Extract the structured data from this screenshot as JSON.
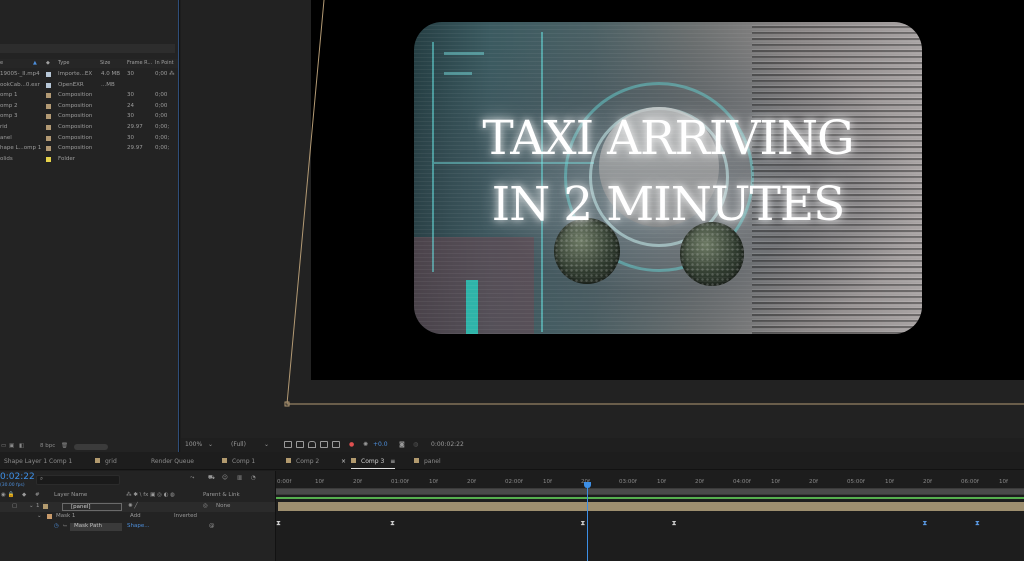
{
  "project": {
    "columns": {
      "name": "e",
      "type": "Type",
      "size": "Size",
      "frame_rate": "Frame R...",
      "in_point": "In Point"
    },
    "items": [
      {
        "name": "19005-_II.mp4",
        "type": "Importe...EX",
        "size": "4.0 MB",
        "frame_rate": "30",
        "in_point": "0;00",
        "color": "#b7c7d7"
      },
      {
        "name": "ookCab...0.exr",
        "type": "OpenEXR",
        "size": "...MB",
        "frame_rate": "",
        "in_point": "",
        "color": "#b7c7d7"
      },
      {
        "name": "omp 1",
        "type": "Composition",
        "size": "",
        "frame_rate": "30",
        "in_point": "0;00",
        "color": "#b39a74"
      },
      {
        "name": "omp 2",
        "type": "Composition",
        "size": "",
        "frame_rate": "24",
        "in_point": "0;00",
        "color": "#b39a74"
      },
      {
        "name": "omp 3",
        "type": "Composition",
        "size": "",
        "frame_rate": "30",
        "in_point": "0;00",
        "color": "#b39a74"
      },
      {
        "name": "rid",
        "type": "Composition",
        "size": "",
        "frame_rate": "29.97",
        "in_point": "0;00;",
        "color": "#b39a74"
      },
      {
        "name": "anel",
        "type": "Composition",
        "size": "",
        "frame_rate": "30",
        "in_point": "0;00;",
        "color": "#b39a74"
      },
      {
        "name": "hape L...omp 1",
        "type": "Composition",
        "size": "",
        "frame_rate": "29.97",
        "in_point": "0;00;",
        "color": "#b39a74"
      },
      {
        "name": "olids",
        "type": "Folder",
        "size": "",
        "frame_rate": "",
        "in_point": "",
        "color": "#e6d24a"
      }
    ],
    "footer_bpc": "8 bpc"
  },
  "viewer": {
    "title_line1": "TAXI ARRIVING",
    "title_line2": "IN 2 MINUTES",
    "zoom": "100%",
    "resolution": "(Full)",
    "exposure": "+0.0",
    "current_time": "0:00:02:22"
  },
  "tabs": [
    {
      "label": "Shape Layer 1 Comp 1",
      "active": false
    },
    {
      "label": "grid",
      "active": false
    },
    {
      "label": "Render Queue",
      "active": false
    },
    {
      "label": "Comp 1",
      "active": false
    },
    {
      "label": "Comp 2",
      "active": false
    },
    {
      "label": "Comp 3",
      "active": true
    },
    {
      "label": "panel",
      "active": false
    }
  ],
  "timeline": {
    "timecode": "0:02:22",
    "timecode_sub": "(30.00 fps)",
    "columns": {
      "layer_name": "Layer Name",
      "parent": "Parent & Link"
    },
    "layer": {
      "index": "1",
      "name": "[panel]",
      "parent": "None"
    },
    "mask": {
      "name": "Mask 1",
      "mode": "Add",
      "inverted": "Inverted"
    },
    "mask_path": {
      "name": "Mask Path",
      "value": "Shape..."
    },
    "ruler": [
      "0:00f",
      "10f",
      "20f",
      "01:00f",
      "10f",
      "20f",
      "02:00f",
      "10f",
      "20f",
      "03:00f",
      "10f",
      "20f",
      "04:00f",
      "10f",
      "20f",
      "05:00f",
      "10f",
      "20f",
      "06:00f",
      "10f"
    ],
    "playhead_seconds": 2.73,
    "keyframes_seconds": [
      0,
      1.0,
      2.67,
      3.47,
      5.67,
      6.13
    ],
    "selected_keyframes_seconds": [
      5.67,
      6.13
    ]
  }
}
